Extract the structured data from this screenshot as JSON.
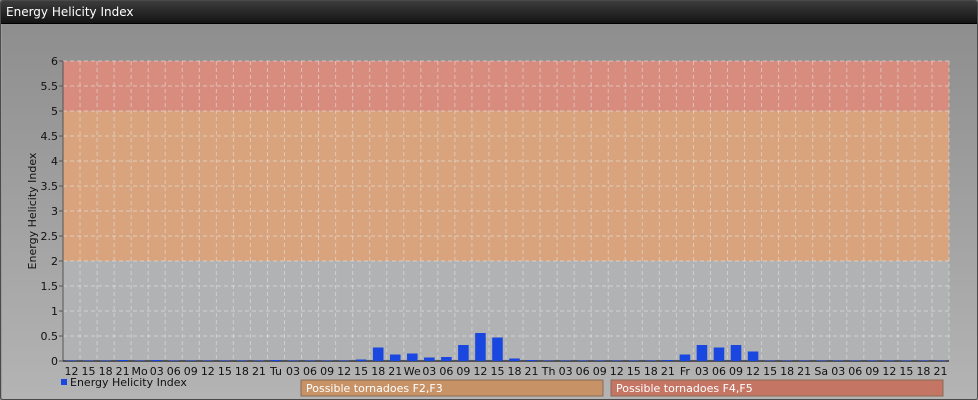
{
  "window": {
    "title": "Energy Helicity Index"
  },
  "chart_data": {
    "type": "bar",
    "title": "",
    "ylabel": "Energy Helicity Index",
    "xlabel": "",
    "ylim": [
      0,
      6
    ],
    "yticks": [
      "0",
      "0.5",
      "1",
      "1.5",
      "2",
      "2.5",
      "3",
      "3.5",
      "4",
      "4.5",
      "5",
      "5.5",
      "6"
    ],
    "grid": true,
    "bands": [
      {
        "from": 2,
        "to": 5,
        "color": "#e0a070"
      },
      {
        "from": 5,
        "to": 6,
        "color": "#e08472"
      }
    ],
    "categories": [
      "12",
      "15",
      "18",
      "21",
      "Mo",
      "03",
      "06",
      "09",
      "12",
      "15",
      "18",
      "21",
      "Tu",
      "03",
      "06",
      "09",
      "12",
      "15",
      "18",
      "21",
      "We",
      "03",
      "06",
      "09",
      "12",
      "15",
      "18",
      "21",
      "Th",
      "03",
      "06",
      "09",
      "12",
      "15",
      "18",
      "21",
      "Fr",
      "03",
      "06",
      "09",
      "12",
      "15",
      "18",
      "21",
      "Sa",
      "03",
      "06",
      "09",
      "12",
      "15",
      "18",
      "21"
    ],
    "series": [
      {
        "name": "Energy Helicity Index",
        "color": "#1a47e0",
        "values": [
          0.01,
          0.01,
          0.01,
          0.02,
          0.01,
          0.02,
          0.01,
          0.01,
          0.01,
          0.01,
          0.01,
          0.01,
          0.02,
          0.01,
          0.01,
          0.01,
          0.01,
          0.03,
          0.27,
          0.13,
          0.15,
          0.07,
          0.08,
          0.32,
          0.56,
          0.47,
          0.05,
          0.02,
          0.01,
          0.01,
          0.01,
          0.01,
          0.01,
          0.01,
          0.01,
          0.02,
          0.13,
          0.32,
          0.27,
          0.32,
          0.19,
          0.01,
          0.01,
          0.01,
          0.01,
          0.01,
          0.01,
          0.01,
          0.01,
          0.01,
          0.01,
          0.01
        ]
      }
    ],
    "legend_position": "bottom-left",
    "annotations": [
      {
        "label": "Possible tornadoes F2,F3",
        "color": "#c79266"
      },
      {
        "label": "Possible tornadoes F4,F5",
        "color": "#c47563"
      }
    ]
  }
}
